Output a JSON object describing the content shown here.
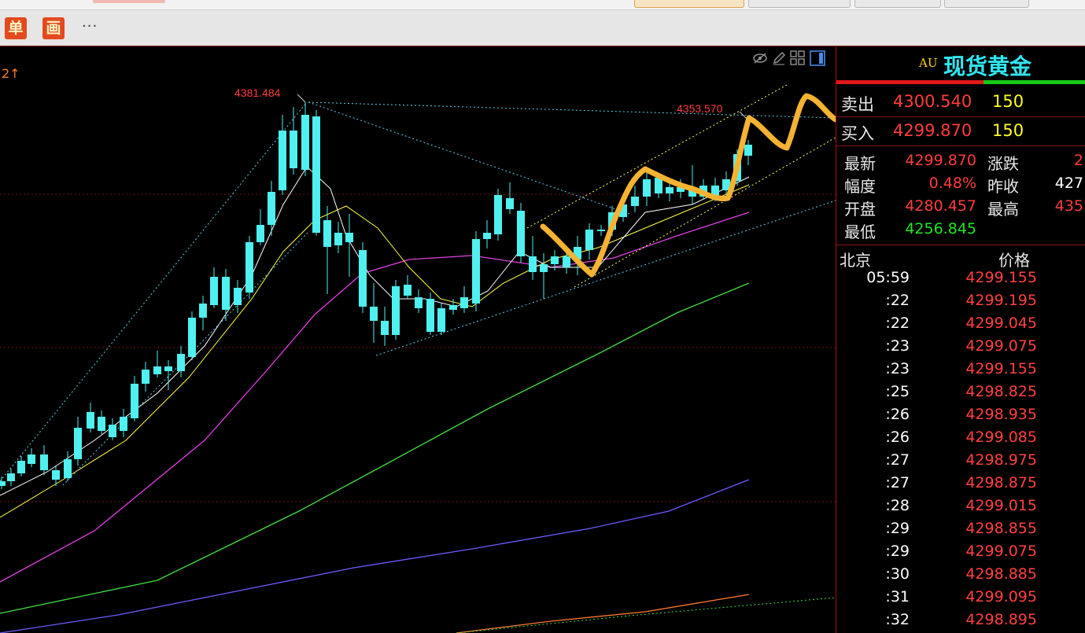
{
  "toolbar": {
    "btn_single": "单",
    "btn_draw": "画",
    "more": "···"
  },
  "chart": {
    "indicator_label": "2↑",
    "peak_label": "4381.484",
    "recent_high_label": "4353.570",
    "colors": {
      "up_candle": "#e03030",
      "down_candle": "#4ff0f0",
      "ma_fast": "#ffffff",
      "ma_mid": "#ffff40",
      "ma_slow": "#e040e0",
      "ma_long": "#40e040",
      "ma_longer": "#6a5cff",
      "ma_longest": "#ff7a30",
      "trendline": "#60d0f0",
      "annotation": "#f5b332"
    }
  },
  "quote": {
    "code": "AU",
    "name": "现货黄金",
    "sell_label": "卖出",
    "sell_price": "4300.540",
    "sell_qty": "150",
    "buy_label": "买入",
    "buy_price": "4299.870",
    "buy_qty": "150",
    "latest_label": "最新",
    "latest_value": "4299.870",
    "change_label": "涨跌",
    "change_value": "2",
    "amplitude_label": "幅度",
    "amplitude_value": "0.48%",
    "prev_close_label": "昨收",
    "prev_close_value": "427",
    "open_label": "开盘",
    "open_value": "4280.457",
    "high_label": "最高",
    "high_value": "435",
    "low_label": "最低",
    "low_value": "4256.845"
  },
  "ticks": {
    "time_header": "北京",
    "price_header": "价格",
    "rows": [
      {
        "time": "05:59",
        "price": "4299.155"
      },
      {
        "time": ":22",
        "price": "4299.195"
      },
      {
        "time": ":22",
        "price": "4299.045"
      },
      {
        "time": ":23",
        "price": "4299.075"
      },
      {
        "time": ":23",
        "price": "4299.155"
      },
      {
        "time": ":25",
        "price": "4298.825"
      },
      {
        "time": ":26",
        "price": "4298.935"
      },
      {
        "time": ":26",
        "price": "4299.085"
      },
      {
        "time": ":27",
        "price": "4298.975"
      },
      {
        "time": ":27",
        "price": "4298.875"
      },
      {
        "time": ":28",
        "price": "4299.015"
      },
      {
        "time": ":29",
        "price": "4298.855"
      },
      {
        "time": ":29",
        "price": "4299.075"
      },
      {
        "time": ":30",
        "price": "4298.885"
      },
      {
        "time": ":31",
        "price": "4299.095"
      },
      {
        "time": ":32",
        "price": "4298.895"
      }
    ]
  }
}
